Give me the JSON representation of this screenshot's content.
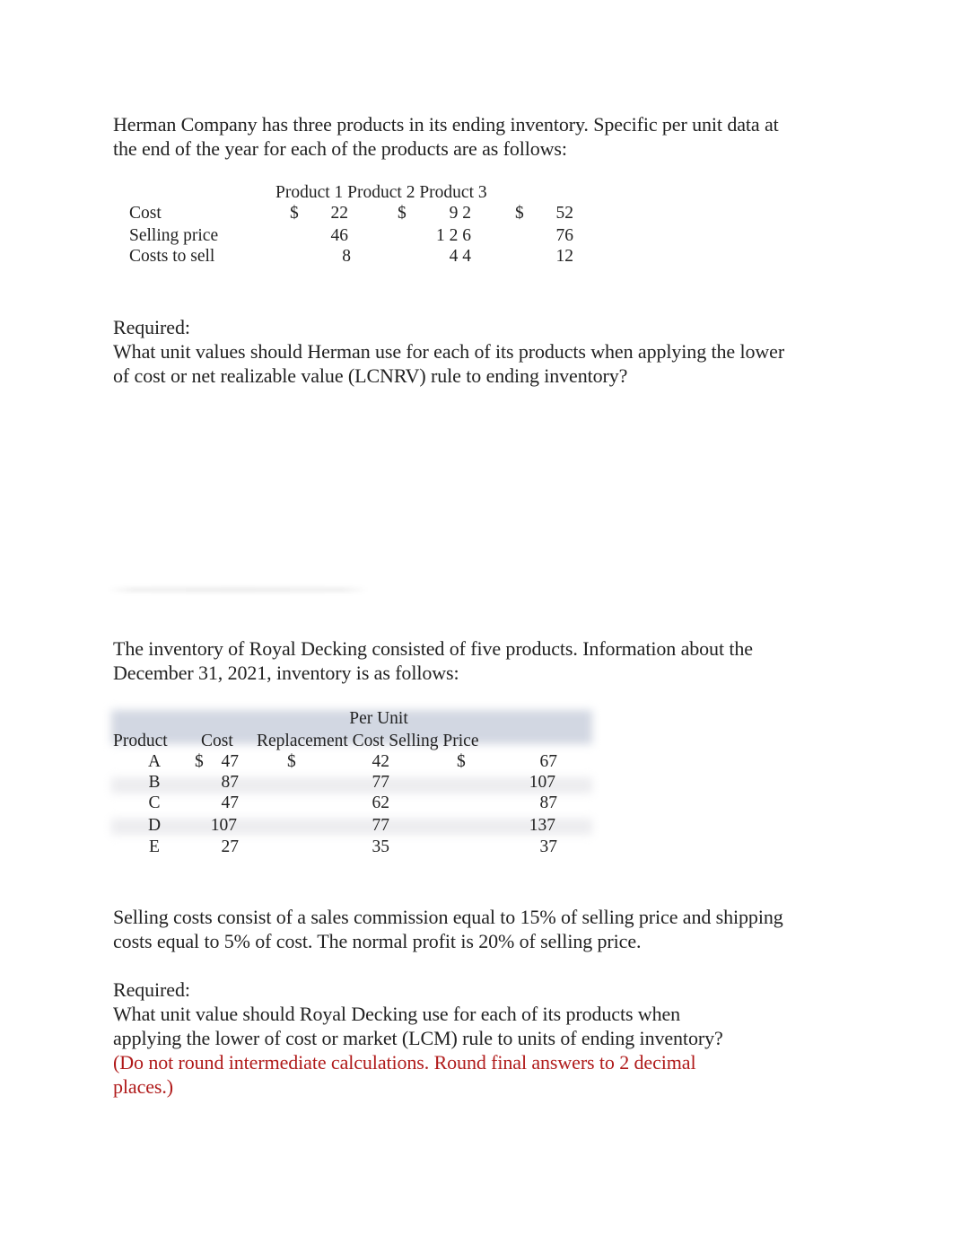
{
  "problem1": {
    "intro": "Herman Company has three products in its ending inventory. Specific per unit data at the end of the year for each of the products are as follows:",
    "table": {
      "header": "Product 1 Product 2 Product 3",
      "columns": [
        "Product 1",
        "Product 2",
        "Product 3"
      ],
      "currency_symbol": "$",
      "rows": [
        {
          "label": "Cost",
          "values": [
            "22",
            "9 2",
            "52"
          ],
          "show_currency": true
        },
        {
          "label": "Selling price",
          "values": [
            "46",
            "1 2 6",
            "76"
          ],
          "show_currency": false
        },
        {
          "label": "Costs to sell",
          "values": [
            "8",
            "4 4",
            "12"
          ],
          "show_currency": false
        }
      ]
    },
    "required_label": "Required:",
    "question": "What unit values should Herman use for each of its products when applying the lower of cost or net realizable value (LCNRV) rule to ending inventory?"
  },
  "problem2": {
    "intro": "The inventory of Royal Decking consisted of five products. Information about the December 31, 2021, inventory is as follows:",
    "table": {
      "group_header": "Per Unit",
      "headers": [
        "Product",
        "Cost",
        "Replacement Cost",
        "Selling Price"
      ],
      "header_line": "Replacement Cost Selling Price",
      "currency_symbol": "$",
      "rows": [
        {
          "product": "A",
          "cost": "47",
          "replacement_cost": "42",
          "selling_price": "67",
          "show_currency": true
        },
        {
          "product": "B",
          "cost": "87",
          "replacement_cost": "77",
          "selling_price": "107",
          "show_currency": false
        },
        {
          "product": "C",
          "cost": "47",
          "replacement_cost": "62",
          "selling_price": "87",
          "show_currency": false
        },
        {
          "product": "D",
          "cost": "107",
          "replacement_cost": "77",
          "selling_price": "137",
          "show_currency": false
        },
        {
          "product": "E",
          "cost": "27",
          "replacement_cost": "35",
          "selling_price": "37",
          "show_currency": false
        }
      ]
    },
    "selling_costs_note": "Selling costs consist of a sales commission equal to 15% of selling price and shipping costs equal to 5% of cost. The normal profit is 20% of selling price.",
    "required_label": "Required:",
    "question": "What unit value should Royal Decking use for each of its products when applying the lower of cost or market (LCM) rule to units of ending inventory?",
    "instruction": "(Do not round intermediate calculations. Round final answers to 2 decimal places.)",
    "instruction_color": "#b01a1a"
  }
}
